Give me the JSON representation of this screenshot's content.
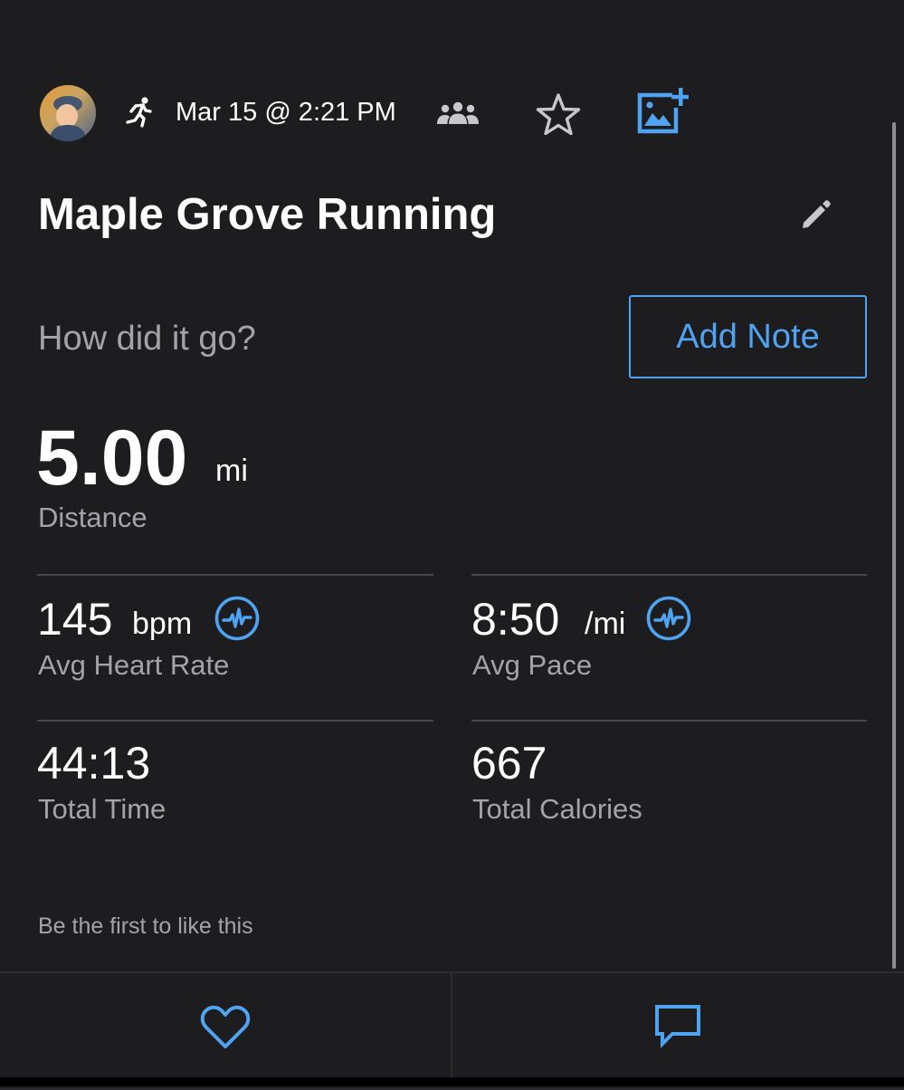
{
  "header": {
    "avatar_icon": "user-avatar",
    "activity_icon": "running-figure-icon",
    "date": "Mar 15 @ 2:21 PM",
    "privacy_icon": "group-icon",
    "favorite_icon": "star-outline-icon",
    "add_photo_icon": "add-photo-icon"
  },
  "activity": {
    "title": "Maple Grove Running",
    "edit_icon": "pencil-icon"
  },
  "note": {
    "prompt": "How did it go?",
    "button_label": "Add Note"
  },
  "distance": {
    "value": "5.00",
    "unit": "mi",
    "label": "Distance"
  },
  "stats": [
    {
      "value": "145",
      "unit": "bpm",
      "label": "Avg Heart Rate",
      "icon": "pulse-icon"
    },
    {
      "value": "8:50",
      "unit": "/mi",
      "label": "Avg Pace",
      "icon": "pulse-icon"
    },
    {
      "value": "44:13",
      "unit": "",
      "label": "Total Time"
    },
    {
      "value": "667",
      "unit": "",
      "label": "Total Calories"
    }
  ],
  "social": {
    "likes_text": "Be the first to like this",
    "like_icon": "heart-outline-icon",
    "comment_icon": "comment-icon"
  },
  "colors": {
    "background": "#1d1d1f",
    "accent": "#4fa3f0",
    "secondary_text": "#a4a4a8",
    "divider": "#48484c"
  }
}
